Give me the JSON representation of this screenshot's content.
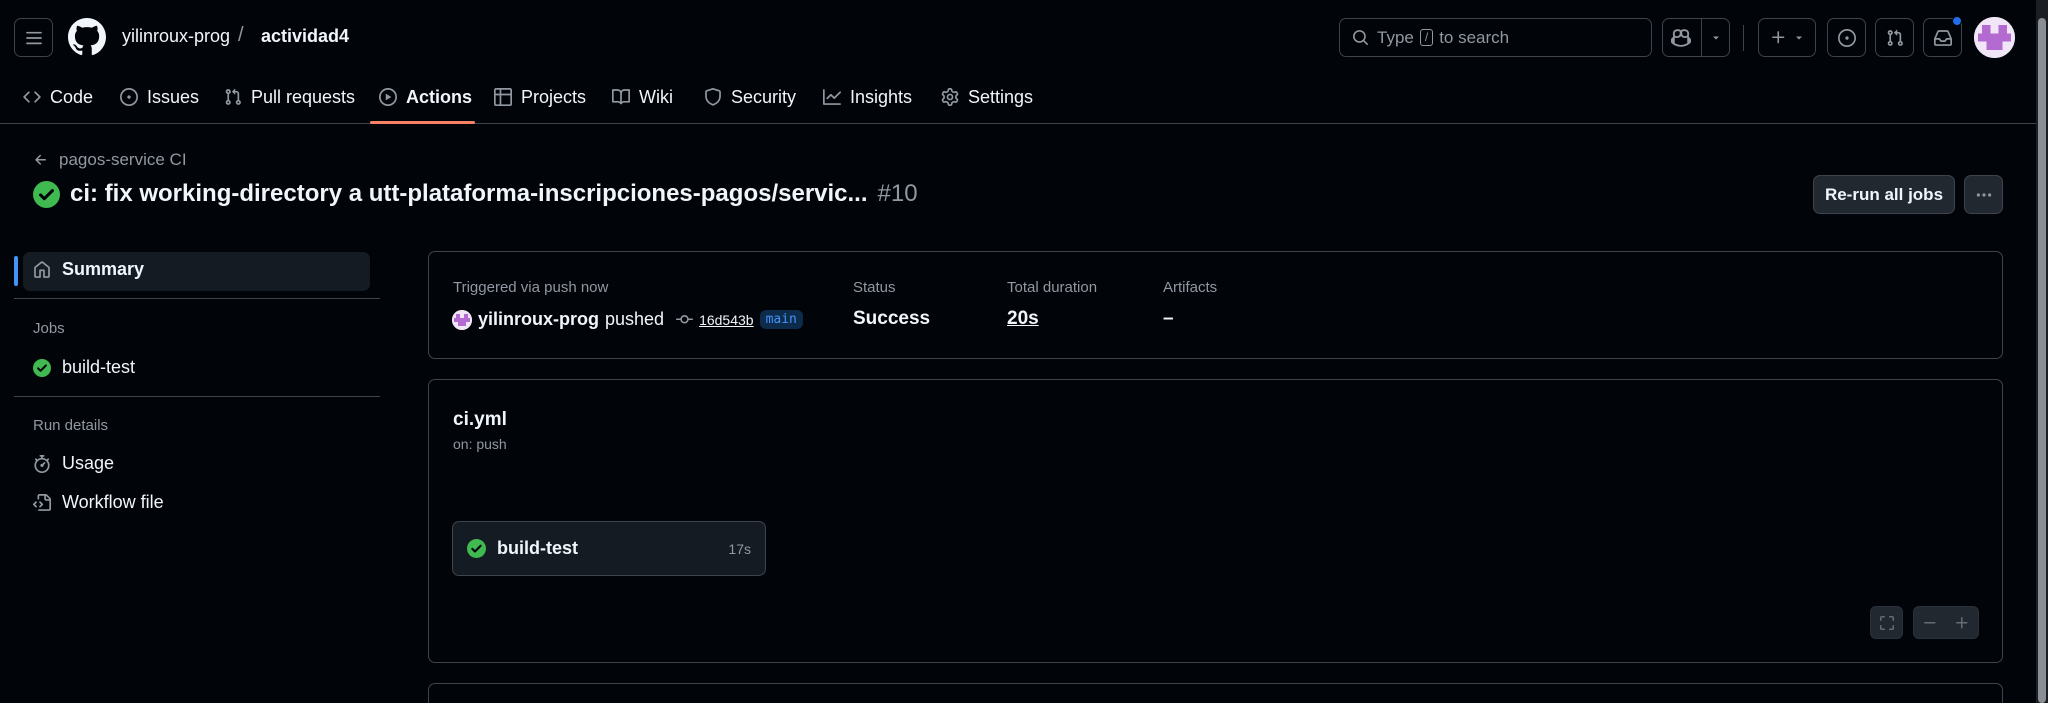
{
  "header": {
    "owner": "yilinroux-prog",
    "separator": "/",
    "repo": "actividad4",
    "search": {
      "prefix": "Type",
      "key": "/",
      "suffix": "to search"
    }
  },
  "tabs": [
    {
      "label": "Code",
      "icon": "code-icon"
    },
    {
      "label": "Issues",
      "icon": "issue-icon"
    },
    {
      "label": "Pull requests",
      "icon": "pull-request-icon"
    },
    {
      "label": "Actions",
      "icon": "play-icon",
      "active": true
    },
    {
      "label": "Projects",
      "icon": "table-icon"
    },
    {
      "label": "Wiki",
      "icon": "book-icon"
    },
    {
      "label": "Security",
      "icon": "shield-icon"
    },
    {
      "label": "Insights",
      "icon": "graph-icon"
    },
    {
      "label": "Settings",
      "icon": "gear-icon"
    }
  ],
  "run": {
    "back_label": "pagos-service CI",
    "title": "ci: fix working-directory a utt-plataforma-inscripciones-pagos/servic...",
    "number": "#10",
    "rerun_label": "Re-run all jobs"
  },
  "sidebar": {
    "summary_label": "Summary",
    "jobs_heading": "Jobs",
    "jobs": [
      {
        "label": "build-test"
      }
    ],
    "run_details_heading": "Run details",
    "details": [
      {
        "label": "Usage",
        "icon": "stopwatch-icon"
      },
      {
        "label": "Workflow file",
        "icon": "file-code-icon"
      }
    ]
  },
  "summary": {
    "trigger_label": "Triggered via push now",
    "actor": "yilinroux-prog",
    "action": "pushed",
    "commit_sha": "16d543b",
    "branch": "main",
    "status_label": "Status",
    "status_value": "Success",
    "duration_label": "Total duration",
    "duration_value": "20s",
    "artifacts_label": "Artifacts",
    "artifacts_value": "–"
  },
  "workflow": {
    "file": "ci.yml",
    "trigger": "on: push",
    "job": {
      "name": "build-test",
      "duration": "17s"
    }
  },
  "colors": {
    "accent_blue": "#4493f8",
    "success_green": "#3fb950",
    "tab_underline": "#f78166"
  }
}
